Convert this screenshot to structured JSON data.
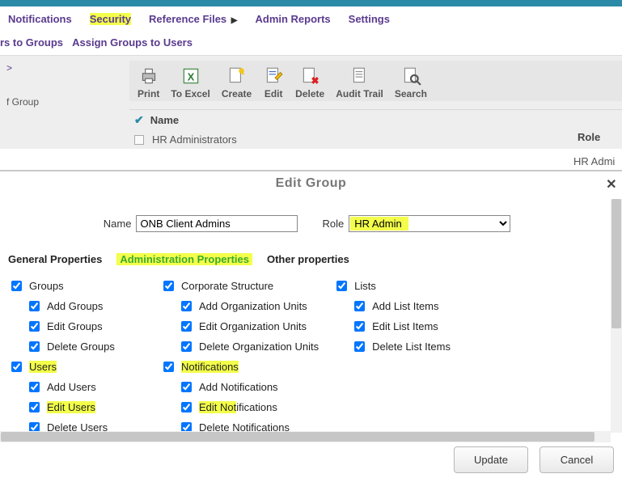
{
  "topnav": {
    "notifications": "Notifications",
    "security": "Security",
    "reference_files": "Reference Files",
    "admin_reports": "Admin Reports",
    "settings": "Settings"
  },
  "subnav": {
    "left": "rs to Groups",
    "right": "Assign Groups to Users"
  },
  "left": {
    "breadcrumb": ">",
    "subtitle": "f Group"
  },
  "toolbar": {
    "print": "Print",
    "to_excel": "To Excel",
    "create": "Create",
    "edit": "Edit",
    "delete": "Delete",
    "audit_trail": "Audit Trail",
    "search": "Search"
  },
  "grid": {
    "col_name": "Name",
    "col_role": "Role",
    "row1_name": "HR Administrators",
    "row1_role": "HR Admi"
  },
  "modal": {
    "title": "Edit Group",
    "name_label": "Name",
    "name_value": "ONB Client Admins",
    "role_label": "Role",
    "role_value": "HR Admin",
    "tabs": {
      "general": "General Properties",
      "admin": "Administration Properties",
      "other": "Other properties"
    },
    "perms": {
      "groups": "Groups",
      "add_groups": "Add Groups",
      "edit_groups": "Edit Groups",
      "delete_groups": "Delete Groups",
      "users": "Users",
      "add_users": "Add Users",
      "edit_users": "Edit Users",
      "delete_users_cut": "Delete Users",
      "corp_structure": "Corporate Structure",
      "add_ou": "Add Organization Units",
      "edit_ou": "Edit Organization Units",
      "delete_ou": "Delete Organization Units",
      "notifications": "Notifications",
      "add_notifications": "Add Notifications",
      "edit_notifications": "Edit Notifications",
      "delete_notifications_cut": "Delete Notifications",
      "lists": "Lists",
      "add_list": "Add List Items",
      "edit_list": "Edit List Items",
      "delete_list": "Delete List Items"
    },
    "update_btn": "Update",
    "cancel_btn": "Cancel"
  }
}
